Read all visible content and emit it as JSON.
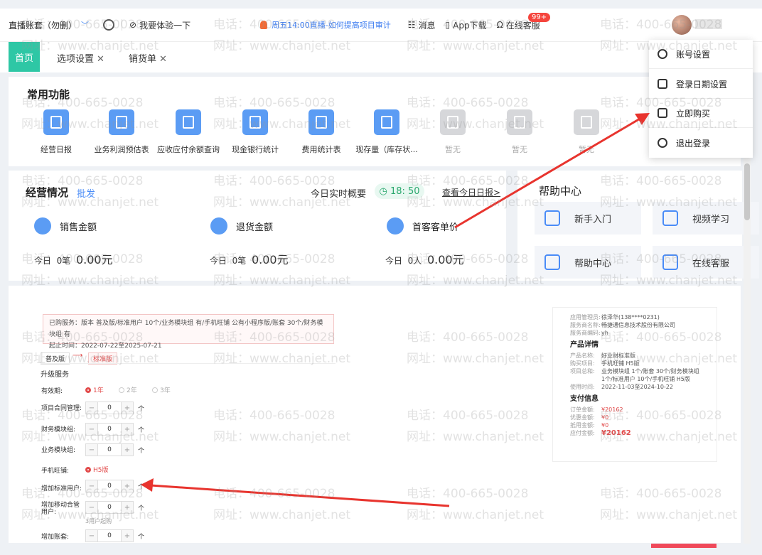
{
  "topbar": {
    "account": "直播账套（勿删）",
    "experience": "我要体验一下",
    "live_notice": "周五14:00直播-如何提高项目审计",
    "messages": "消息",
    "message_badge": "99+",
    "app_download": "App下载",
    "online_service": "在线客服"
  },
  "tabs": [
    "首页",
    "选项设置",
    "销货单"
  ],
  "common_functions": {
    "title": "常用功能",
    "items": [
      {
        "label": "经营日报",
        "enabled": true
      },
      {
        "label": "业务利润预估表",
        "enabled": true
      },
      {
        "label": "应收应付余额查询",
        "enabled": true
      },
      {
        "label": "现金银行统计",
        "enabled": true
      },
      {
        "label": "费用统计表",
        "enabled": true
      },
      {
        "label": "现存量（库存状...",
        "enabled": true
      },
      {
        "label": "暂无",
        "enabled": false
      },
      {
        "label": "暂无",
        "enabled": false
      },
      {
        "label": "暂无",
        "enabled": false
      }
    ]
  },
  "business": {
    "title": "经营情况",
    "batch": "批发",
    "realtime_label": "今日实时概要",
    "time": "18: 50",
    "view_daily": "查看今日日报>",
    "metrics": [
      {
        "label": "销售金额",
        "today": "今日",
        "count": "0笔",
        "amount": "0.00元"
      },
      {
        "label": "退货金额",
        "today": "今日",
        "count": "0笔",
        "amount": "0.00元"
      },
      {
        "label": "首客客单价",
        "today": "今日",
        "count": "0人",
        "amount": "0.00元"
      }
    ]
  },
  "help_center": {
    "title": "帮助中心",
    "items": [
      "新手入门",
      "视频学习",
      "帮助中心",
      "在线客服"
    ]
  },
  "user_menu": {
    "items": [
      "账号设置",
      "登录日期设置",
      "立即购买",
      "退出登录"
    ]
  },
  "upgrade_panel": {
    "purchased_line1": "已购服务：版本 普及版/标准用户 10个/业务模块组 有/手机旺铺 公有小程序版/账套 30个/财务模块组 有",
    "purchased_line2": "起止时间：2022-07-22至2025-07-21",
    "version_from": "普及版",
    "version_to": "标准版",
    "section_title": "升级服务",
    "validity_label": "有效期:",
    "validity_options": [
      "1年",
      "2年",
      "3年"
    ],
    "project_contract": "项目合同管理:",
    "finance_module": "财务模块组:",
    "business_module": "业务模块组:",
    "mobile_shop": "手机旺铺:",
    "mobile_shop_value": "H5版",
    "add_standard_user": "增加标准用户:",
    "add_mobile_manager": "增加移动合管用户:",
    "add_account": "增加账套:",
    "stepper_value": "0",
    "unit": "个",
    "user_note": "3用户起购"
  },
  "order_detail": {
    "admin_label": "应用管理员:",
    "admin_value": "徐泽华(138****0231)",
    "vendor_label": "服务商名称:",
    "vendor_value": "畅捷通信息技术股份有限公司",
    "code_label": "服务商编码:",
    "code_value": "yh",
    "product_title": "产品详情",
    "product_name_label": "产品名称:",
    "product_name_value": "好业财标准版",
    "buy_label": "购买项目:",
    "buy_value": "手机旺铺 H5版",
    "project_label": "项目总和:",
    "project_value": "业务模块组 1个/账套 30个/财务模块组 1个/标准用户 10个/手机旺铺 H5版",
    "use_time_label": "使用时间:",
    "use_time_value": "2022-11-03至2024-10-22",
    "pay_title": "支付信息",
    "order_amount_label": "订单金额:",
    "order_amount_value": "¥20162",
    "discount_label": "优惠金额:",
    "discount_value": "¥0",
    "deduct_label": "抵用金额:",
    "deduct_value": "¥0",
    "payable_label": "应付金额:",
    "payable_value": "¥20162"
  },
  "watermark": {
    "phone": "电话：400-665-0028",
    "site": "网址：www.chanjet.net"
  },
  "colors": {
    "accent_blue": "#4a8cf7",
    "home_tab": "#2ec7a5",
    "arrow_red": "#e8342e",
    "badge_red": "#f5453d"
  }
}
